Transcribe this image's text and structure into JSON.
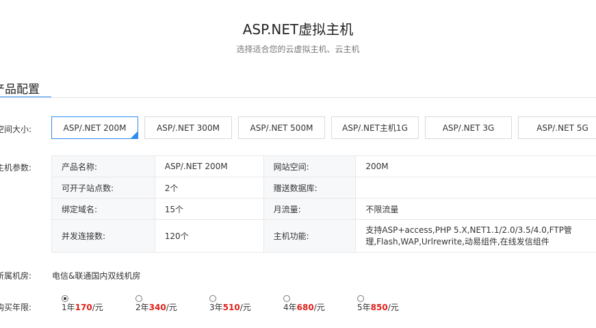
{
  "page": {
    "title": "ASP.NET虚拟主机",
    "subtitle": "选择适合您的云虚拟主机、云主机"
  },
  "section": {
    "tab_label": "产品配置"
  },
  "labels": {
    "space": "空间大小:",
    "params": "主机参数:",
    "datacenter": "所属机房:",
    "period": "购买年限:"
  },
  "space_options": [
    {
      "label": "ASP/.NET 200M",
      "selected": true
    },
    {
      "label": "ASP/.NET 300M",
      "selected": false
    },
    {
      "label": "ASP/.NET 500M",
      "selected": false
    },
    {
      "label": "ASP/.NET主机1G",
      "selected": false
    },
    {
      "label": "ASP/.NET 3G",
      "selected": false
    },
    {
      "label": "ASP/.NET 5G",
      "selected": false
    }
  ],
  "params": {
    "rows": [
      {
        "k1": "产品名称:",
        "v1": "ASP/.NET 200M",
        "k2": "网站空间:",
        "v2": "200M"
      },
      {
        "k1": "可开子站点数:",
        "v1": "2个",
        "k2": "赠送数据库:",
        "v2": ""
      },
      {
        "k1": "绑定域名:",
        "v1": "15个",
        "k2": "月流量:",
        "v2": "不限流量"
      },
      {
        "k1": "并发连接数:",
        "v1": "120个",
        "k2": "主机功能:",
        "v2_line1": "支持ASP+access,PHP 5.X,NET1.1/2.0/3.5/4.0,FTP管",
        "v2_line2": "理,Flash,WAP,Urlrewrite,动易组件,在线发信组件"
      }
    ]
  },
  "datacenter": {
    "value": "电信&联通国内双线机房"
  },
  "periods": [
    {
      "years": "1年",
      "price": "170",
      "unit": "/元",
      "checked": true
    },
    {
      "years": "2年",
      "price": "340",
      "unit": "/元",
      "checked": false
    },
    {
      "years": "3年",
      "price": "510",
      "unit": "/元",
      "checked": false
    },
    {
      "years": "4年",
      "price": "680",
      "unit": "/元",
      "checked": false
    },
    {
      "years": "5年",
      "price": "850",
      "unit": "/元",
      "checked": false
    }
  ],
  "colors": {
    "accent": "#2d8cf0",
    "price": "#e0201a"
  }
}
